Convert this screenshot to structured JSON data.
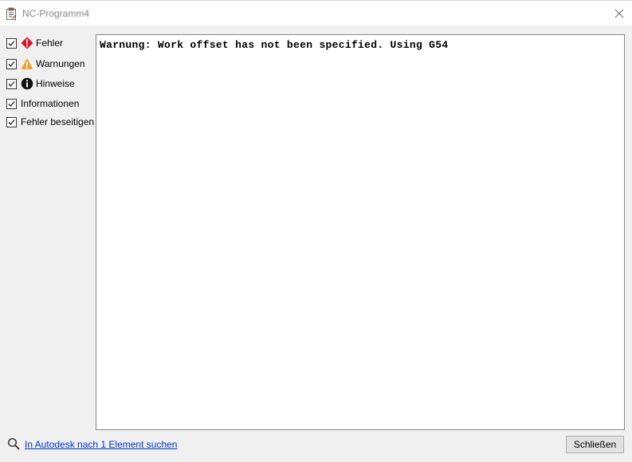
{
  "window": {
    "title": "NC-Programm4",
    "accent_color": "#c01818"
  },
  "filters": [
    {
      "label": "Fehler",
      "checked": true,
      "icon": "error-icon",
      "icon_color": "#e81123"
    },
    {
      "label": "Warnungen",
      "checked": true,
      "icon": "warning-icon",
      "icon_color": "#f0a030"
    },
    {
      "label": "Hinweise",
      "checked": true,
      "icon": "info-icon",
      "icon_color": "#000000"
    },
    {
      "label": "Informationen",
      "checked": true,
      "icon": null
    },
    {
      "label": "Fehler beseitigen",
      "checked": true,
      "icon": null
    }
  ],
  "messages": [
    "Warnung: Work offset has not been specified. Using G54"
  ],
  "footer": {
    "search_link": "In Autodesk nach 1 Element suchen",
    "close_label": "Schließen",
    "link_color": "#0033cc"
  }
}
